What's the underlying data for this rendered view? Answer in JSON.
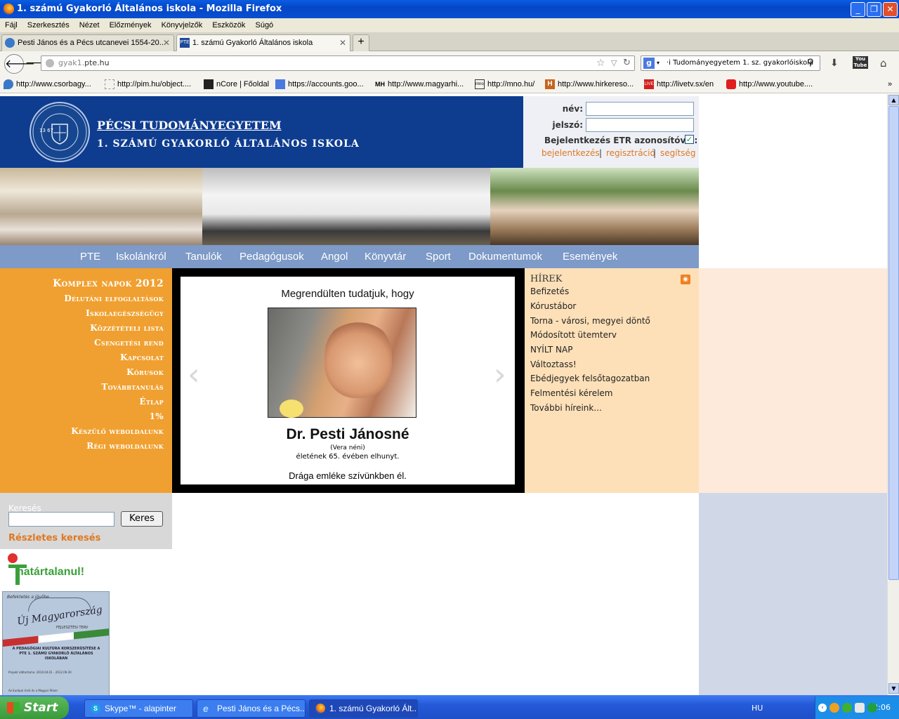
{
  "window": {
    "title": "1. számú Gyakorló Általános iskola - Mozilla Firefox"
  },
  "menu": [
    "Fájl",
    "Szerkesztés",
    "Nézet",
    "Előzmények",
    "Könyvjelzők",
    "Eszközök",
    "Súgó"
  ],
  "tabs": [
    {
      "label": "Pesti János és a Pécs utcanevei 1554-20..."
    },
    {
      "label": "1. számú Gyakorló Általános iskola"
    }
  ],
  "url": {
    "prefix": "gyak1.",
    "domain": "pte.hu"
  },
  "search": {
    "value": "·i Tudományegyetem 1. sz. gyakorlóiskola"
  },
  "bookmarks": [
    "http://www.csorbagy...",
    "http://pim.hu/object....",
    "nCore | Főoldal",
    "https://accounts.goo...",
    "http://www.magyarhi...",
    "http://mno.hu/",
    "http://www.hirkereso...",
    "http://livetv.sx/en",
    "http://www.youtube...."
  ],
  "header": {
    "university": "PÉCSI TUDOMÁNYEGYETEM",
    "school": "1. SZÁMÚ GYAKORLÓ ÁLTALÁNOS ISKOLA",
    "seal_text": "UNIVERSITAS QUINQUEECCLESIENSIS",
    "seal_years": "13 67"
  },
  "login": {
    "name_label": "név:",
    "password_label": "jelszó:",
    "etr_label": "Bejelentkezés ETR azonosítóval:",
    "links": [
      "bejelentkezés",
      "regisztráció",
      "segítség"
    ],
    "separator": "|"
  },
  "nav": [
    "PTE",
    "Iskolánkról",
    "Tanulók",
    "Pedagógusok",
    "Angol",
    "Könyvtár",
    "Sport",
    "Dokumentumok",
    "Események"
  ],
  "left_menu": [
    "Komplex napok 2012",
    "Délutáni elfoglaltások",
    "Iskolaegészségügy",
    "Közzétételi lista",
    "Csengetési rend",
    "Kapcsolat",
    "Kórusok",
    "Továbbtanulás",
    "Étlap",
    "1%",
    "Készülő weboldalunk",
    "Régi weboldalunk"
  ],
  "slide": {
    "heading": "Megrendülten tudatjuk, hogy",
    "name": "Dr. Pesti Jánosné",
    "nickname": "(Vera néni)",
    "age_text": "életének 65. évében elhunyt.",
    "closing": "Drága emléke szívünkben él."
  },
  "news": {
    "title": "HÍREK",
    "items": [
      "Befizetés",
      "Kórustábor",
      "Torna - városi, megyei döntő",
      "Módosított ütemterv",
      "NYÍLT NAP",
      "Változtass!",
      "Ebédjegyek felsőtagozatban",
      "Felmentési kérelem",
      "További híreink..."
    ]
  },
  "site_search": {
    "label": "Keresés",
    "button": "Keres",
    "advanced": "Részletes keresés"
  },
  "banners": {
    "hatartalanul": "határtalanul!",
    "ujm_top": "Befektetés a jövőbe",
    "ujm_title": "Új Magyarország",
    "ujm_sub": "FEJLESZTÉSI TERV",
    "ujm_body": "A PEDAGÓGIAI KULTÚRA KORSZERŰSÍTÉSE A PTE 1. SZÁMÚ GYAKORLÓ ÁLTALÁNOS ISKOLÁBAN",
    "ujm_dates": "Projekt időtartama: 2010.04.01 - 2012.09.30.",
    "ujm_footer": "Az Európai Unió és a Magyar Állam"
  },
  "taskbar": {
    "start": "Start",
    "buttons": [
      "Skype™ - alapinter",
      "Pesti János és a Pécs...",
      "1. számú Gyakorló Ált..."
    ],
    "lang": "HU",
    "clock": "22:06"
  },
  "colors": {
    "header_blue": "#0e3c8f",
    "nav_blue": "#7d9ac8",
    "menu_orange": "#f0a030",
    "news_bg": "#fde0b8",
    "link_orange": "#e07820"
  }
}
